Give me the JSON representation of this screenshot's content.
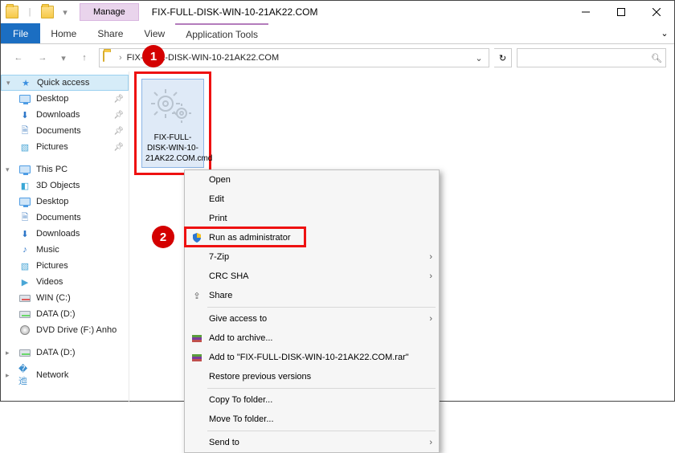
{
  "title": "FIX-FULL-DISK-WIN-10-21AK22.COM",
  "ribbon": {
    "contextual_heading": "Manage",
    "file": "File",
    "tabs": [
      "Home",
      "Share",
      "View"
    ],
    "contextual_tab": "Application Tools"
  },
  "address": {
    "path": "FIX-FULL-DISK-WIN-10-21AK22.COM"
  },
  "search_placeholder": "",
  "sidebar": {
    "quick": "Quick access",
    "quick_items": [
      {
        "label": "Desktop"
      },
      {
        "label": "Downloads"
      },
      {
        "label": "Documents"
      },
      {
        "label": "Pictures"
      }
    ],
    "thispc": "This PC",
    "pc_items": [
      {
        "label": "3D Objects"
      },
      {
        "label": "Desktop"
      },
      {
        "label": "Documents"
      },
      {
        "label": "Downloads"
      },
      {
        "label": "Music"
      },
      {
        "label": "Pictures"
      },
      {
        "label": "Videos"
      },
      {
        "label": "WIN (C:)"
      },
      {
        "label": "DATA (D:)"
      },
      {
        "label": "DVD Drive (F:) Anho"
      }
    ],
    "datae": "DATA (D:)",
    "network": "Network"
  },
  "file_tile": "FIX-FULL-DISK-WIN-10-21AK22.COM.cmd",
  "ctx": {
    "open": "Open",
    "edit": "Edit",
    "print": "Print",
    "runas": "Run as administrator",
    "sevenzip": "7-Zip",
    "crc": "CRC SHA",
    "share": "Share",
    "give": "Give access to",
    "addarchive": "Add to archive...",
    "addrar": "Add to \"FIX-FULL-DISK-WIN-10-21AK22.COM.rar\"",
    "restore": "Restore previous versions",
    "copyto": "Copy To folder...",
    "moveto": "Move To folder...",
    "sendto": "Send to"
  },
  "badges": {
    "one": "1",
    "two": "2"
  }
}
